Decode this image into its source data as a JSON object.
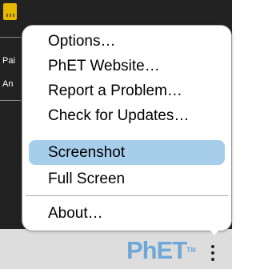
{
  "sim": {
    "label_1": "Pai",
    "label_2": "An"
  },
  "menu": {
    "items": [
      {
        "label": "Options…"
      },
      {
        "label": "PhET Website…"
      },
      {
        "label": "Report a Problem…"
      },
      {
        "label": "Check for Updates…"
      },
      {
        "label": "Screenshot",
        "highlighted": true
      },
      {
        "label": "Full Screen"
      },
      {
        "label": "About…"
      }
    ],
    "highlight_color": "#a6cdea"
  },
  "navbar": {
    "logo_text": "PhET",
    "logo_tm": "TM",
    "logo_color": "#6fa8d6"
  }
}
